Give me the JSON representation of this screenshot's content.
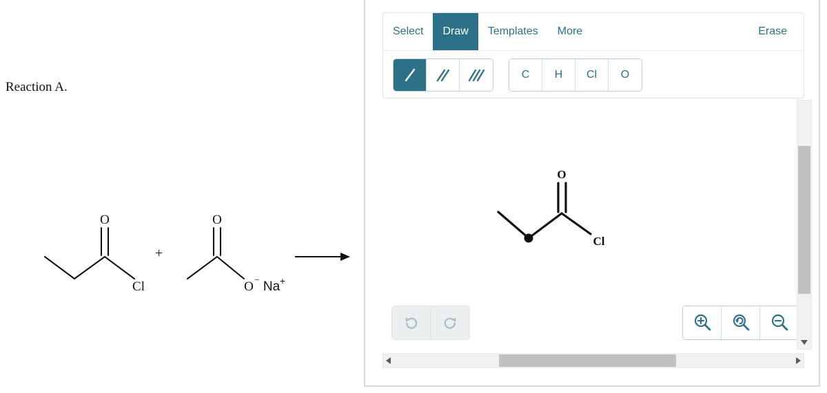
{
  "question": {
    "label": "Reaction A."
  },
  "reaction": {
    "reactant_1": {
      "name": "propanoyl-chloride",
      "atom_labels": [
        "O",
        "Cl"
      ]
    },
    "plus": "+",
    "reactant_2": {
      "name": "sodium-acetate",
      "atom_labels": [
        "O",
        "O",
        "−",
        "Na",
        "+"
      ]
    },
    "arrow": "reaction-arrow"
  },
  "editor": {
    "menu": [
      {
        "label": "Select",
        "active": false,
        "name": "select"
      },
      {
        "label": "Draw",
        "active": true,
        "name": "draw"
      },
      {
        "label": "Templates",
        "active": false,
        "name": "templates"
      },
      {
        "label": "More",
        "active": false,
        "name": "more"
      }
    ],
    "erase_label": "Erase",
    "bond_tools": [
      {
        "label": "single-bond-icon",
        "active": true
      },
      {
        "label": "double-bond-icon",
        "active": false
      },
      {
        "label": "triple-bond-icon",
        "active": false
      }
    ],
    "element_tools": [
      {
        "label": "C",
        "active": false
      },
      {
        "label": "H",
        "active": false
      },
      {
        "label": "Cl",
        "active": false
      },
      {
        "label": "O",
        "active": false
      }
    ],
    "history_controls": [
      {
        "name": "undo",
        "icon": "undo-icon",
        "enabled": false
      },
      {
        "name": "redo",
        "icon": "redo-icon",
        "enabled": false
      }
    ],
    "zoom_controls": [
      {
        "name": "zoom-in",
        "icon": "zoom-in-icon"
      },
      {
        "name": "zoom-reset",
        "icon": "zoom-reset-icon"
      },
      {
        "name": "zoom-out",
        "icon": "zoom-out-icon"
      }
    ],
    "canvas_molecule": {
      "name": "propanoyl-chloride",
      "atom_labels": [
        "O",
        "Cl"
      ],
      "selected_vertex": true
    }
  },
  "colors": {
    "accent": "#2d7189",
    "accent_border": "#b9cfd8",
    "panel_border": "#d7d7d7",
    "scrollbar_thumb": "#c1c1c1",
    "scrollbar_track": "#f1f1f1",
    "disabled_icon": "#a8bfc9",
    "structure_stroke": "#14120f"
  }
}
